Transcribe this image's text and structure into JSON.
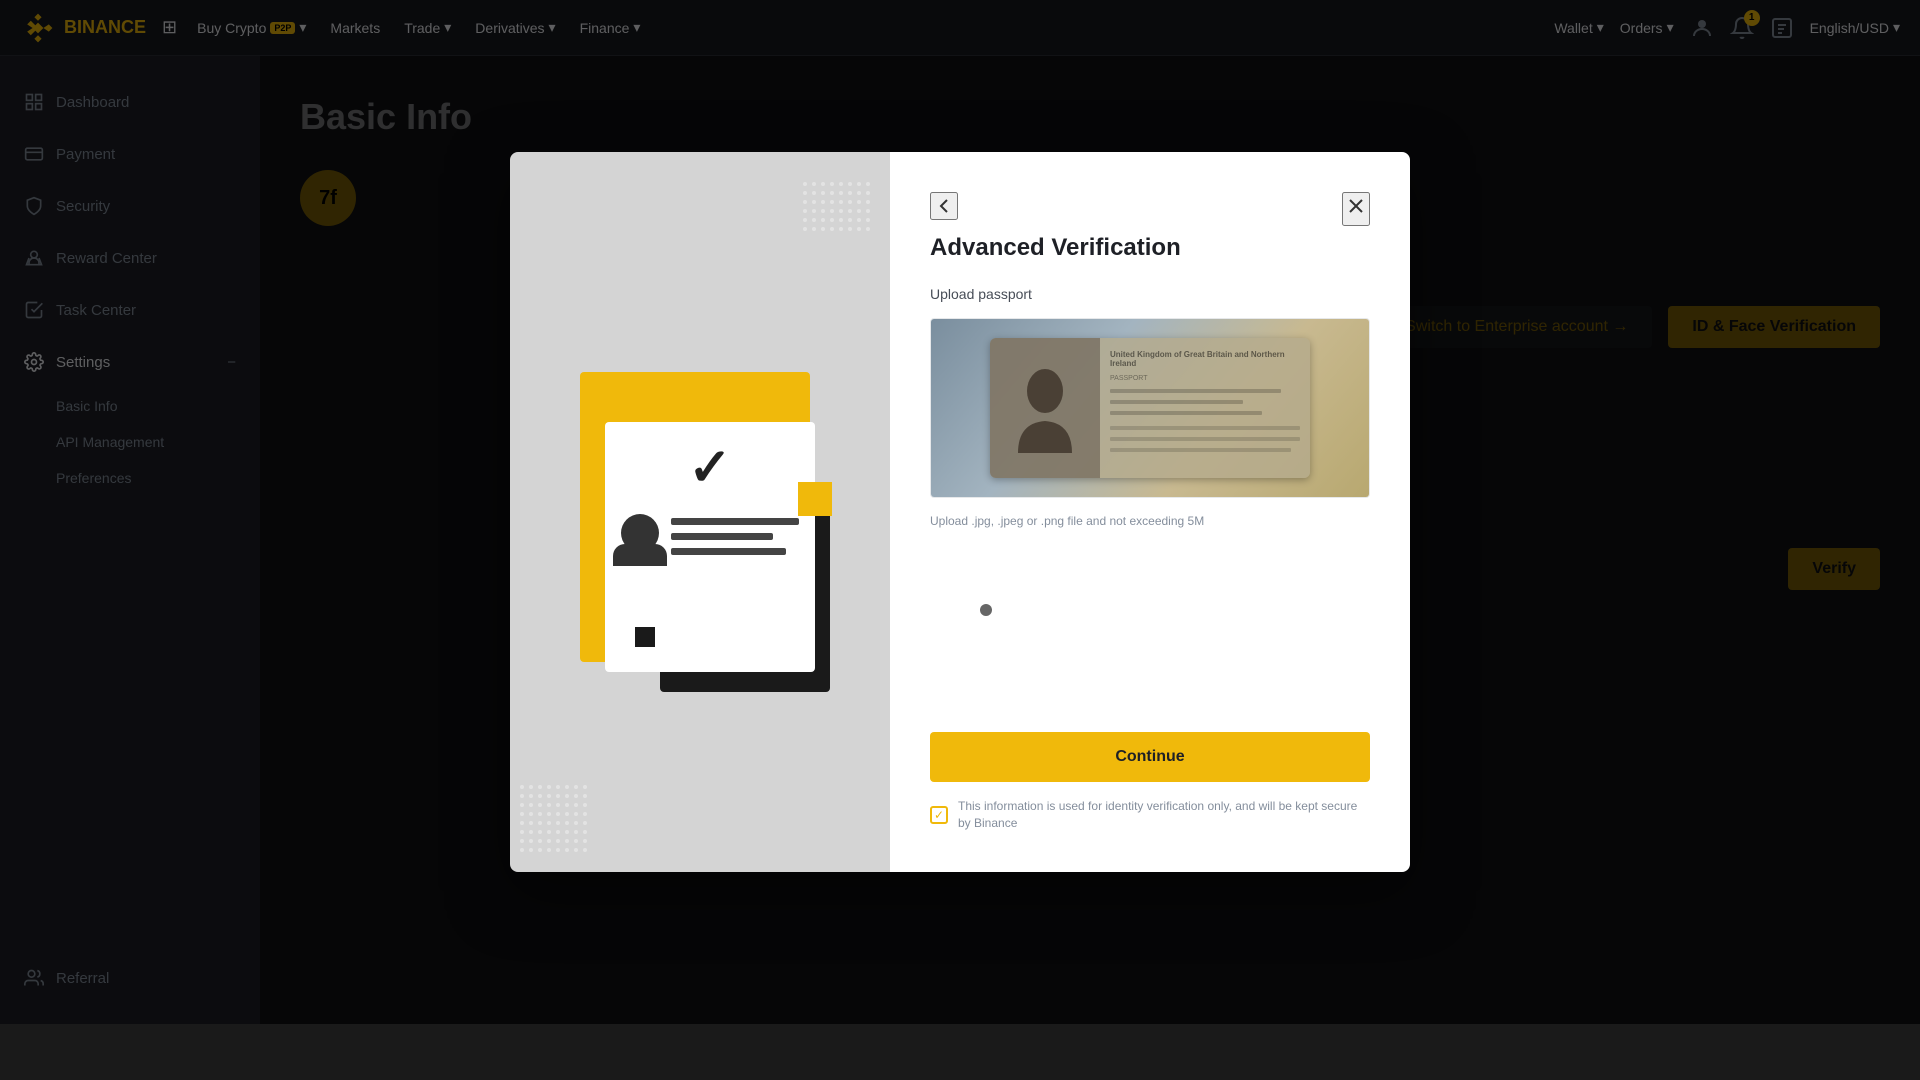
{
  "topnav": {
    "logo_text": "BINANCE",
    "grid_icon": "⊞",
    "links": [
      {
        "label": "Buy Crypto",
        "badge": "P2P",
        "has_dropdown": true
      },
      {
        "label": "Markets",
        "has_dropdown": false
      },
      {
        "label": "Trade",
        "has_dropdown": true
      },
      {
        "label": "Derivatives",
        "has_dropdown": true
      },
      {
        "label": "Finance",
        "has_dropdown": true
      }
    ],
    "right_items": [
      {
        "label": "Wallet",
        "has_dropdown": true
      },
      {
        "label": "Orders",
        "has_dropdown": true
      },
      {
        "label": "English/USD",
        "has_dropdown": true
      }
    ]
  },
  "sidebar": {
    "items": [
      {
        "label": "Dashboard",
        "icon": "dashboard"
      },
      {
        "label": "Payment",
        "icon": "payment"
      },
      {
        "label": "Security",
        "icon": "security"
      },
      {
        "label": "Reward Center",
        "icon": "reward"
      },
      {
        "label": "Task Center",
        "icon": "task"
      },
      {
        "label": "Settings",
        "icon": "settings"
      }
    ],
    "sub_items": [
      {
        "label": "Basic Info"
      },
      {
        "label": "API Management"
      },
      {
        "label": "Preferences"
      }
    ],
    "bottom_item": {
      "label": "Referral",
      "icon": "referral"
    }
  },
  "main": {
    "page_title": "Basic Info",
    "user_id_short": "7f",
    "switch_enterprise_label": "Switch to Enterprise account",
    "id_face_label": "ID & Face Verification",
    "verify_label": "Verify"
  },
  "modal": {
    "title": "Advanced Verification",
    "back_label": "←",
    "close_label": "×",
    "section_label": "Upload passport",
    "upload_hint": "Upload .jpg, .jpeg or .png file and not exceeding 5M",
    "continue_label": "Continue",
    "secure_notice": "This information is used for identity verification only, and will be kept secure by Binance"
  }
}
